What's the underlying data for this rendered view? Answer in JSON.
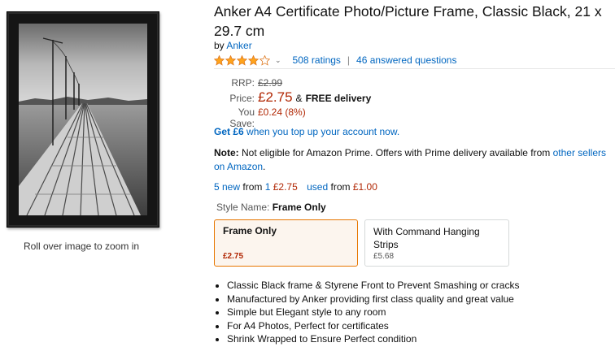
{
  "gallery": {
    "zoom_hint": "Roll over image to zoom in"
  },
  "product": {
    "title": "Anker A4 Certificate Photo/Picture Frame, Classic Black, 21 x 29.7 cm",
    "by_prefix": "by",
    "brand": "Anker",
    "rating_out_of_5": 4,
    "ratings_text": "508 ratings",
    "questions_text": "46 answered questions"
  },
  "pricing": {
    "rrp_label": "RRP:",
    "rrp_value": "£2.99",
    "price_label": "Price:",
    "price_value": "£2.75",
    "delivery_amp": "&",
    "delivery_text": "FREE delivery",
    "save_label": "You Save:",
    "save_value": "£0.24 (8%)"
  },
  "promo": {
    "topup_amount": "Get £6",
    "topup_text": "when you top up your account now."
  },
  "note": {
    "label": "Note:",
    "text": "Not eligible for Amazon Prime. Offers with Prime delivery available from",
    "link": "other sellers on Amazon",
    "end": "."
  },
  "offers": {
    "new_link": "5 new",
    "from1": "from",
    "new_count_link": "1",
    "new_price": "£2.75",
    "used_link": "used",
    "from2": "from",
    "used_price": "£1.00"
  },
  "style": {
    "label": "Style Name:",
    "selected": "Frame Only",
    "options": [
      {
        "name": "Frame Only",
        "price": "£2.75"
      },
      {
        "name": "With Command Hanging Strips",
        "price": "£5.68"
      }
    ]
  },
  "bullets": [
    "Classic Black frame & Styrene Front to Prevent Smashing or cracks",
    "Manufactured by Anker providing first class quality and great value",
    "Simple but Elegant style to any room",
    "For A4 Photos, Perfect for certificates",
    "Shrink Wrapped to Ensure Perfect condition"
  ],
  "colors": {
    "link": "#0066c0",
    "price": "#b12704",
    "star": "#ffa41c",
    "selected_border": "#e77600"
  }
}
